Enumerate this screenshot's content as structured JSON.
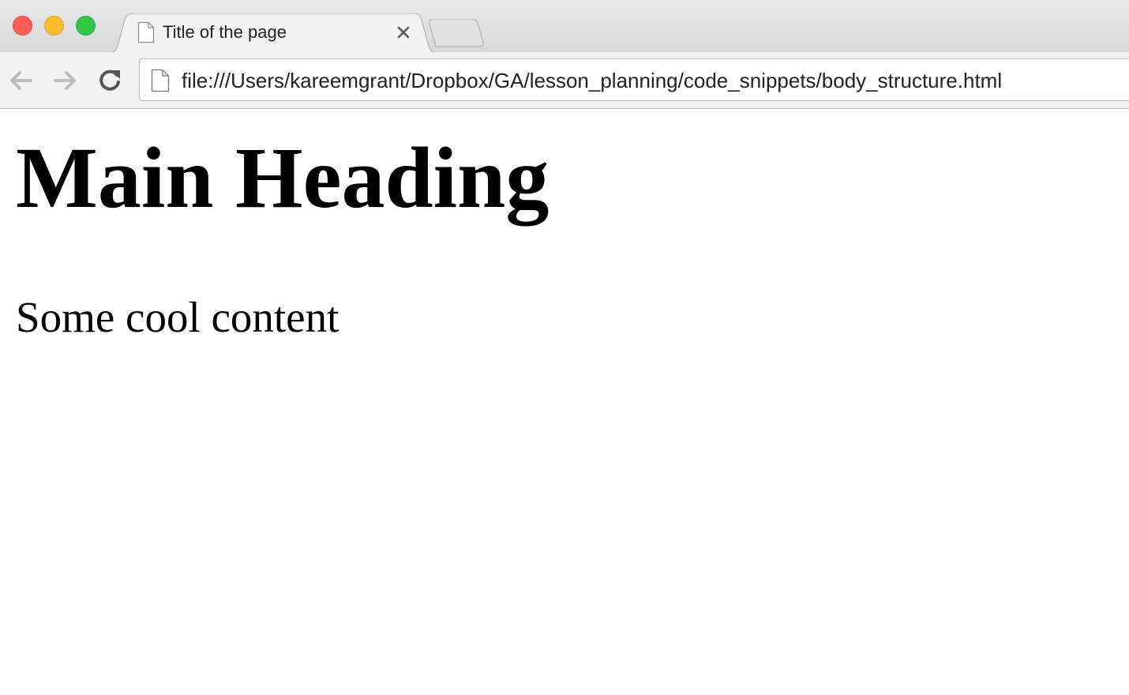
{
  "window": {
    "controls": {
      "close": {
        "icon": "close-dot",
        "color": "#fc5e57"
      },
      "minimize": {
        "icon": "minimize-dot",
        "color": "#fdbc2e"
      },
      "maximize": {
        "icon": "maximize-dot",
        "color": "#33c748"
      }
    }
  },
  "tabs": [
    {
      "title": "Title of the page",
      "icon": "document-icon",
      "active": true
    }
  ],
  "toolbar": {
    "back_icon": "back-arrow-icon",
    "forward_icon": "forward-arrow-icon",
    "reload_icon": "reload-icon",
    "address_icon": "document-icon",
    "url": "file:///Users/kareemgrant/Dropbox/GA/lesson_planning/code_snippets/body_structure.html"
  },
  "page": {
    "heading": "Main Heading",
    "paragraph": "Some cool content"
  }
}
